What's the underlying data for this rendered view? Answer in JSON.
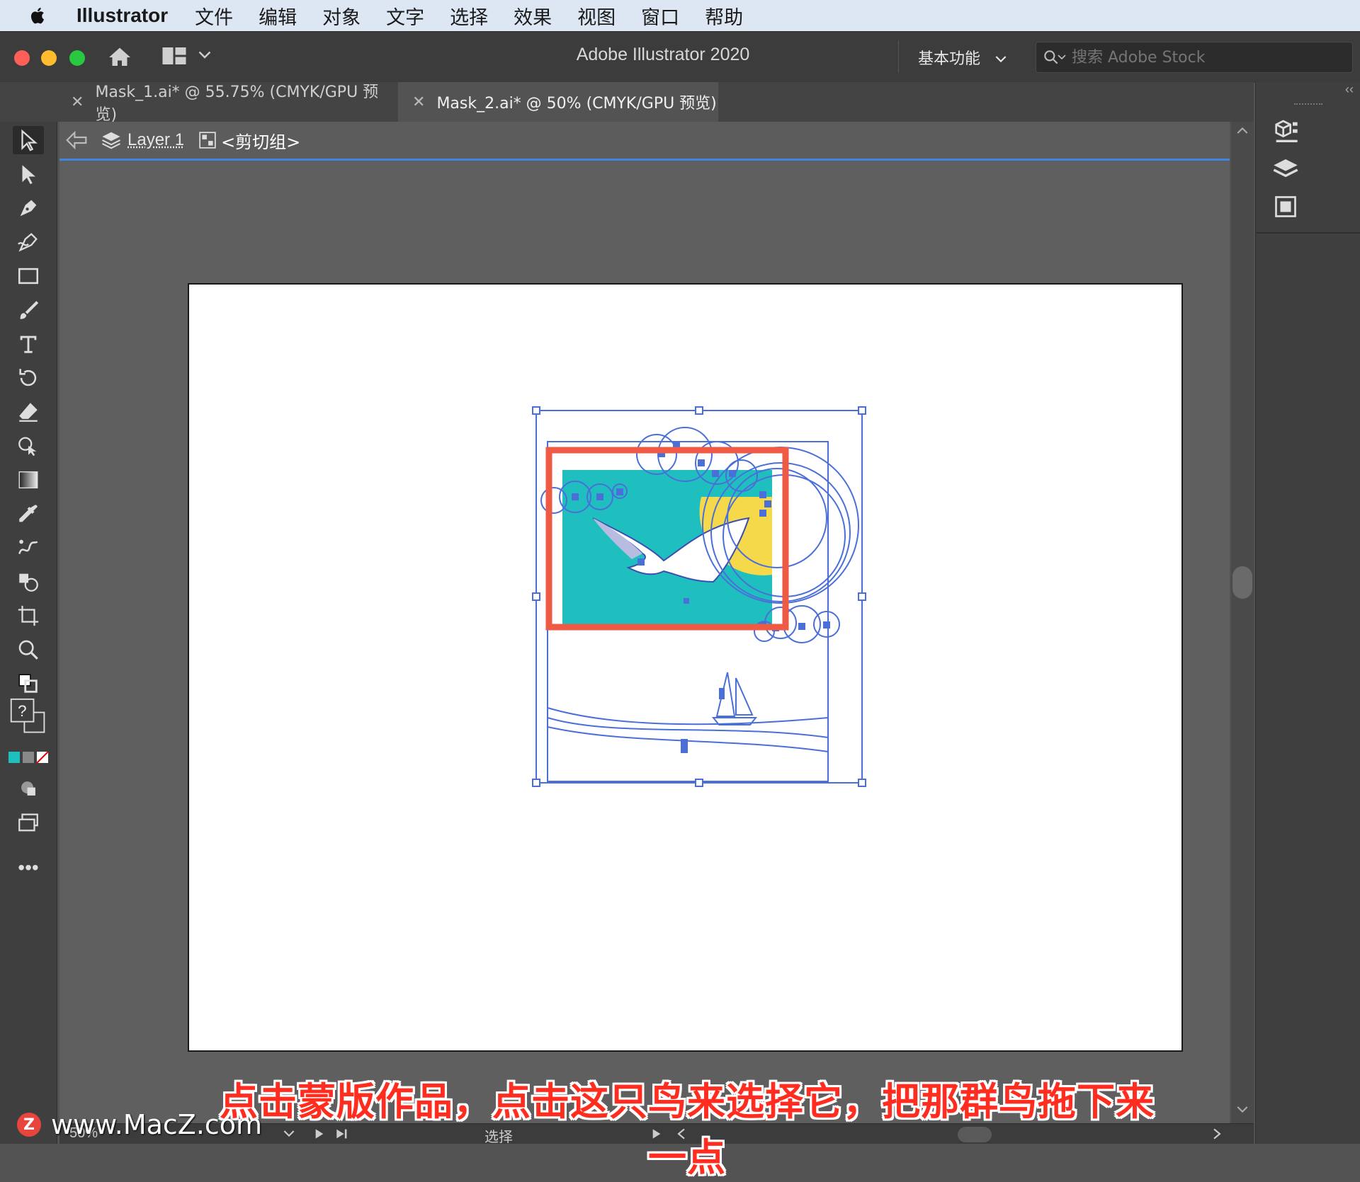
{
  "menubar": {
    "app_name": "Illustrator",
    "items": [
      "文件",
      "编辑",
      "对象",
      "文字",
      "选择",
      "效果",
      "视图",
      "窗口",
      "帮助"
    ]
  },
  "titlebar": {
    "title": "Adobe Illustrator 2020",
    "workspace": "基本功能",
    "search_placeholder": "搜索 Adobe Stock"
  },
  "tabs": [
    {
      "label": "Mask_1.ai* @ 55.75% (CMYK/GPU 预览)",
      "active": false
    },
    {
      "label": "Mask_2.ai* @ 50% (CMYK/GPU 预览)",
      "active": true
    }
  ],
  "breadcrumb": {
    "layer": "Layer 1",
    "group": "<剪切组>"
  },
  "statusbar": {
    "zoom": "50%",
    "mode": "选择"
  },
  "subtitle": "点击蒙版作品，点击这只鸟来选择它，把那群鸟拖下来一点",
  "watermark": "www.MacZ.com",
  "colors": {
    "selection": "#4a6fd9",
    "highlight": "#ef5a45",
    "teal": "#1fbfbf",
    "sun": "#f5d94a"
  }
}
